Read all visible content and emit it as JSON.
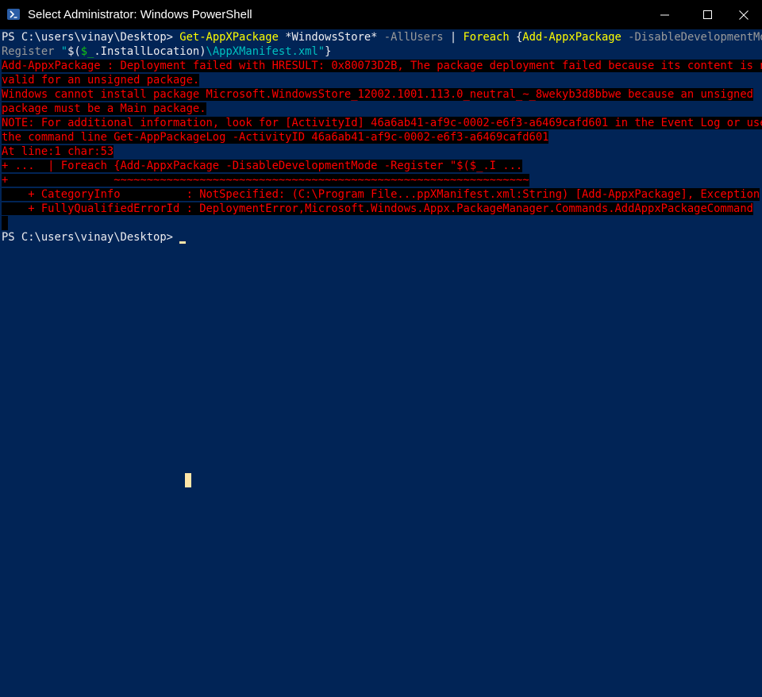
{
  "window": {
    "title": "Select Administrator: Windows PowerShell",
    "icon": "powershell-icon",
    "controls": {
      "minimize": "minimize-icon",
      "maximize": "maximize-icon",
      "close": "close-icon"
    }
  },
  "colors": {
    "background": "#012456",
    "error_text": "#ff0000",
    "error_background": "#000000",
    "command": "#ffff00",
    "parameter": "#9a9a9a",
    "string": "#00c0c0",
    "variable": "#13c413",
    "prompt_text": "#eeedf0"
  },
  "terminal": {
    "cmd1": {
      "prompt": "PS C:\\users\\vinay\\Desktop> ",
      "cmdlet1": "Get-AppXPackage",
      "arg1": " *WindowsStore* ",
      "param1": "-AllUsers",
      "pipe": " | ",
      "foreach": "Foreach",
      "brace_open": " {",
      "cmdlet2": "Add-AppxPackage",
      "param2": " -DisableDevelopmentMode -",
      "param3": "Register",
      "str1": " \"",
      "var_open": "$(",
      "var_name": "$_",
      "var_prop": ".InstallLocation)",
      "str2": "\\AppXManifest.xml\"",
      "brace_close": "}"
    },
    "error_lines": [
      "Add-AppxPackage : Deployment failed with HRESULT: 0x80073D2B, The package deployment failed because its content is not",
      "valid for an unsigned package.",
      "Windows cannot install package Microsoft.WindowsStore_12002.1001.113.0_neutral_~_8wekyb3d8bbwe because an unsigned",
      "package must be a Main package.",
      "NOTE: For additional information, look for [ActivityId] 46a6ab41-af9c-0002-e6f3-a6469cafd601 in the Event Log or use",
      "the command line Get-AppPackageLog -ActivityID 46a6ab41-af9c-0002-e6f3-a6469cafd601",
      "At line:1 char:53",
      "+ ...  | Foreach {Add-AppxPackage -DisableDevelopmentMode -Register \"$($_.I ...",
      "+                ~~~~~~~~~~~~~~~~~~~~~~~~~~~~~~~~~~~~~~~~~~~~~~~~~~~~~~~~~~~~~~~",
      "    + CategoryInfo          : NotSpecified: (C:\\Program File...ppXManifest.xml:String) [Add-AppxPackage], Exception",
      "    + FullyQualifiedErrorId : DeploymentError,Microsoft.Windows.Appx.PackageManager.Commands.AddAppxPackageCommand"
    ],
    "prompt2": "PS C:\\users\\vinay\\Desktop> "
  }
}
